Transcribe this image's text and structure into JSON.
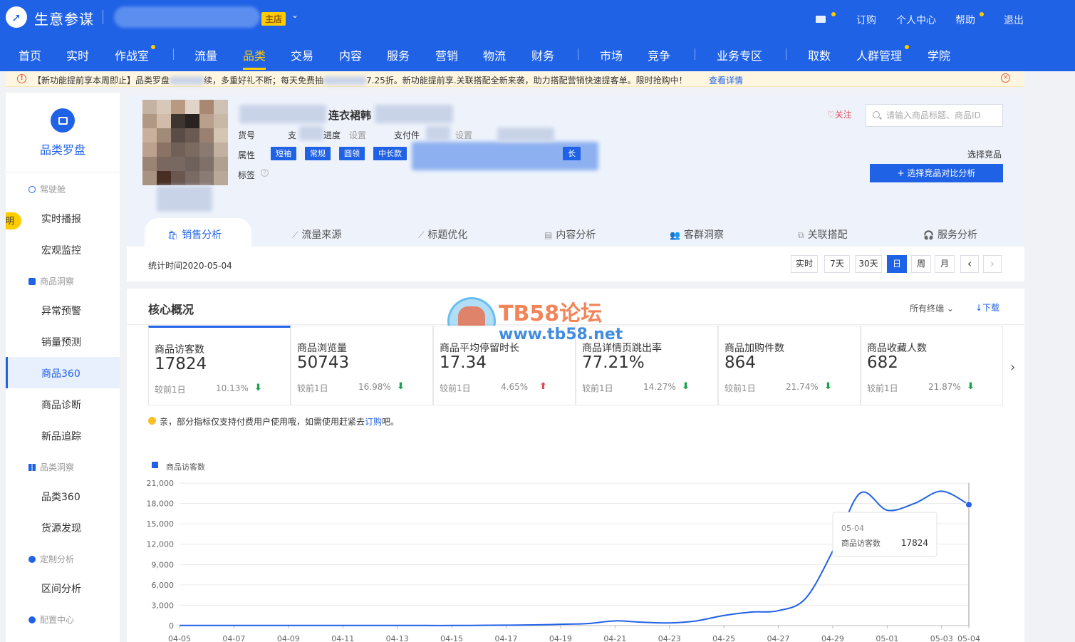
{
  "app": {
    "title": "生意参谋",
    "shop_badge": "主店",
    "shop_caret": "⌄"
  },
  "top_links": {
    "subscribe": "订购",
    "personal": "个人中心",
    "help": "帮助",
    "logout": "退出"
  },
  "nav": [
    "首页",
    "实时",
    "作战室",
    "流量",
    "品类",
    "交易",
    "内容",
    "服务",
    "营销",
    "物流",
    "财务",
    "市场",
    "竞争",
    "业务专区",
    "取数",
    "人群管理",
    "学院"
  ],
  "notice": {
    "text_a": "【新功能提前享本周即止】品类罗盘",
    "text_b": "续，多重好礼不断；每天免费抽",
    "text_c": "7.25折。新功能提前享.关联搭配全新来袭，助力搭配营销快速提客单。限时抢购中！",
    "link": "查看详情"
  },
  "sidebar": {
    "float_label": "明",
    "title": "品类罗盘",
    "groups": {
      "cockpit": "驾驶舱",
      "goods_insight": "商品洞察",
      "category_insight": "品类洞察",
      "custom_analysis": "定制分析",
      "config_center": "配置中心"
    },
    "items": {
      "realtime_report": "实时播报",
      "macro_monitor": "宏观监控",
      "anomaly_alert": "异常预警",
      "sales_forecast": "销量预测",
      "goods360": "商品360",
      "goods_diagnosis": "商品诊断",
      "new_goods_track": "新品追踪",
      "category360": "品类360",
      "source_discovery": "货源发现",
      "interval_analysis": "区间分析"
    }
  },
  "product": {
    "title": "连衣裙韩",
    "labels": {
      "sku_no": "货号",
      "zhi": "支",
      "progress": "进度",
      "set_1": "设置",
      "pay_pieces": "支付件",
      "set_2": "设置",
      "attrs": "属性",
      "tags": "标签"
    },
    "attr_tags": [
      "短袖",
      "常规",
      "圆领",
      "中长款"
    ],
    "attr_tail": "长",
    "help_icon": "?",
    "follow": "关注",
    "search_placeholder": "请输入商品标题、商品ID",
    "pick_label": "选择竞品",
    "pick_button": "+ 选择竞品对比分析"
  },
  "tabs": [
    {
      "label": "销售分析",
      "icon": "🛍"
    },
    {
      "label": "流量来源",
      "icon": "⟋"
    },
    {
      "label": "标题优化",
      "icon": "⟋"
    },
    {
      "label": "内容分析",
      "icon": "▤"
    },
    {
      "label": "客群洞察",
      "icon": "👥"
    },
    {
      "label": "关联搭配",
      "icon": "⧉"
    },
    {
      "label": "服务分析",
      "icon": "🎧"
    }
  ],
  "stat_time": "统计时间2020-05-04",
  "periods": [
    "实时",
    "7天",
    "30天",
    "日",
    "周",
    "月"
  ],
  "period_nav": {
    "prev": "‹",
    "next": "›"
  },
  "core": {
    "title": "核心概况",
    "terminal": "所有终端 ⌄",
    "download": "↓下载",
    "next_icon": "›",
    "metrics": [
      {
        "label": "商品访客数",
        "value": "17824",
        "cmp": "较前1日",
        "pct": "10.13%",
        "trend": "down"
      },
      {
        "label": "商品浏览量",
        "value": "50743",
        "cmp": "较前1日",
        "pct": "16.98%",
        "trend": "down"
      },
      {
        "label": "商品平均停留时长",
        "value": "17.34",
        "cmp": "较前1日",
        "pct": "4.65%",
        "trend": "up"
      },
      {
        "label": "商品详情页跳出率",
        "value": "77.21%",
        "cmp": "较前1日",
        "pct": "14.27%",
        "trend": "down"
      },
      {
        "label": "商品加购件数",
        "value": "864",
        "cmp": "较前1日",
        "pct": "21.74%",
        "trend": "down"
      },
      {
        "label": "商品收藏人数",
        "value": "682",
        "cmp": "较前1日",
        "pct": "21.87%",
        "trend": "down"
      }
    ],
    "tip_prefix": "亲，部分指标仅支持付费用户使用哦，如需使用赶紧去",
    "tip_link": "订购",
    "tip_suffix": "吧。"
  },
  "watermark": {
    "title": "TB58论坛",
    "url": "www.tb58.net"
  },
  "colors": {
    "brand": "#2062e6",
    "accent": "#ffcc00",
    "down": "#1aa34a",
    "up": "#e34d59"
  },
  "chart_data": {
    "type": "line",
    "legend": "商品访客数",
    "y_ticks": [
      "0",
      "3,000",
      "6,000",
      "9,000",
      "12,000",
      "15,000",
      "18,000",
      "21,000"
    ],
    "ylim": [
      0,
      21000
    ],
    "x_ticks": [
      "04-05",
      "04-07",
      "04-09",
      "04-11",
      "04-13",
      "04-15",
      "04-17",
      "04-19",
      "04-21",
      "04-23",
      "04-25",
      "04-27",
      "04-29",
      "05-01",
      "05-03",
      "05-04"
    ],
    "series": [
      {
        "name": "商品访客数",
        "x": [
          "04-05",
          "04-06",
          "04-07",
          "04-08",
          "04-09",
          "04-10",
          "04-11",
          "04-12",
          "04-13",
          "04-14",
          "04-15",
          "04-16",
          "04-17",
          "04-18",
          "04-19",
          "04-20",
          "04-21",
          "04-22",
          "04-23",
          "04-24",
          "04-25",
          "04-26",
          "04-27",
          "04-28",
          "04-29",
          "04-30",
          "05-01",
          "05-02",
          "05-03",
          "05-04"
        ],
        "values": [
          20,
          20,
          20,
          20,
          20,
          20,
          20,
          20,
          20,
          20,
          20,
          40,
          60,
          100,
          200,
          300,
          700,
          500,
          400,
          700,
          1500,
          2000,
          2200,
          4000,
          11000,
          19500,
          17000,
          18000,
          19800,
          17824
        ]
      }
    ],
    "tooltip": {
      "date": "05-04",
      "label": "商品访客数",
      "value": "17824"
    }
  }
}
